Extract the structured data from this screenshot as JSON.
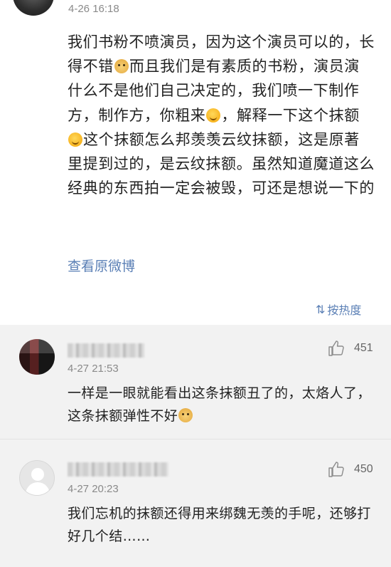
{
  "post": {
    "time": "4-26 16:18",
    "text_segments": [
      "我们书粉不喷演员，因为这个演员可以的，长得不错",
      "而且我们是有素质的书粉，演员演什么不是他们自己决定的，我们喷一下制作方，制作方，你粗来",
      "，解释一下这个抹额",
      "这个抹额怎么邦羡羡云纹抹额，这是原著里提到过的，是云纹抹额。虽然知道魔道这么经典的东西拍一定会被毁，可还是想说一下的"
    ],
    "emojis": [
      "doge-emoji",
      "smile-emoji",
      "smile-emoji"
    ],
    "view_original": "查看原微博",
    "sort_label": "按热度",
    "sort_icon": "⇅"
  },
  "comments": [
    {
      "time": "4-27 21:53",
      "likes": "451",
      "text_segments": [
        "一样是一眼就能看出这条抹额丑了的，太烙人了，这条抹额弹性不好"
      ],
      "emojis": [
        "doge-emoji"
      ]
    },
    {
      "time": "4-27 20:23",
      "likes": "450",
      "text_segments": [
        "我们忘机的抹额还得用来绑魏无羡的手呢，还够打好几个结……"
      ],
      "emojis": []
    }
  ],
  "colors": {
    "link": "#5a7fb5",
    "meta": "#8a8a8a",
    "comment_bg": "#f2f2f2",
    "text": "#222222"
  }
}
